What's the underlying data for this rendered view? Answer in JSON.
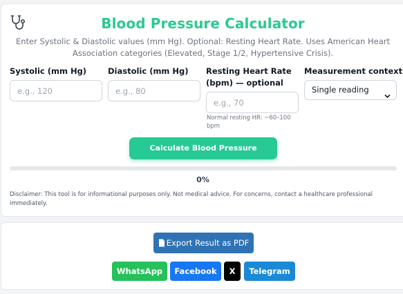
{
  "header": {
    "title": "Blood Pressure Calculator",
    "subtitle": "Enter Systolic & Diastolic values (mm Hg). Optional: Resting Heart Rate. Uses American Heart Association categories (Elevated, Stage 1/2, Hypertensive Crisis).",
    "icon": "stethoscope-icon"
  },
  "form": {
    "systolic": {
      "label": "Systolic (mm Hg)",
      "placeholder": "e.g., 120",
      "value": ""
    },
    "diastolic": {
      "label": "Diastolic (mm Hg)",
      "placeholder": "e.g., 80",
      "value": ""
    },
    "heart_rate": {
      "label": "Resting Heart Rate (bpm) — optional",
      "placeholder": "e.g., 70",
      "value": "",
      "hint": "Normal resting HR: ~60–100 bpm"
    },
    "context": {
      "label": "Measurement context",
      "selected": "Single reading"
    }
  },
  "actions": {
    "calculate_label": "Calculate Blood Pressure"
  },
  "progress": {
    "percent": 0,
    "label": "0%"
  },
  "disclaimer": "Disclaimer: This tool is for informational purposes only. Not medical advice. For concerns, contact a healthcare professional immediately.",
  "share": {
    "export_label": "Export Result as PDF",
    "whatsapp": "WhatsApp",
    "facebook": "Facebook",
    "x": "X",
    "telegram": "Telegram"
  },
  "colors": {
    "accent": "#27c994",
    "title": "#2bc98f",
    "pdf": "#2f73b5",
    "whatsapp": "#25c15a",
    "facebook": "#1877f2",
    "x": "#000000",
    "telegram": "#1a8ad6"
  }
}
